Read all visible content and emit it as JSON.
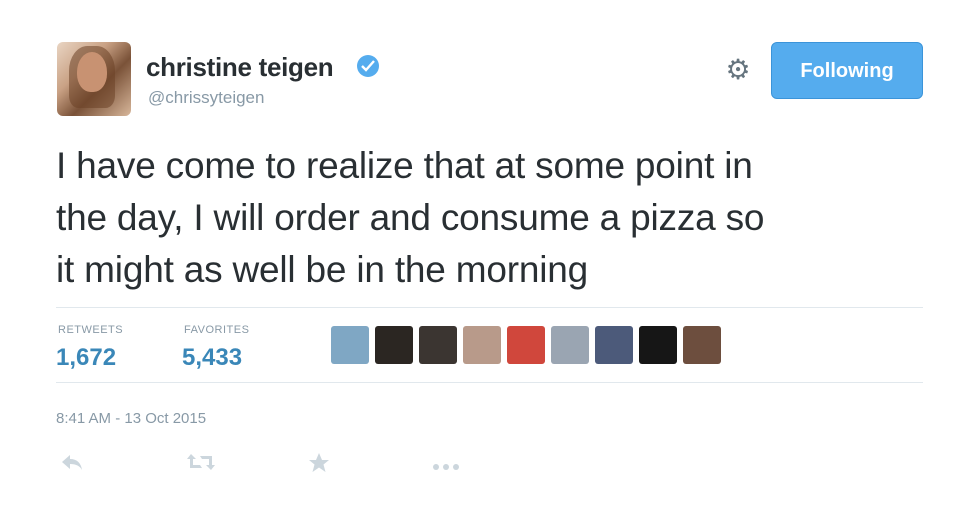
{
  "author": {
    "display_name": "christine teigen",
    "handle": "@chrissyteigen",
    "verified_icon": "verified-badge-icon"
  },
  "header": {
    "follow_label": "Following",
    "gear_icon": "gear-icon"
  },
  "tweet": {
    "text_line1": "I have come to realize that at some point in",
    "text_line2": "the day, I will order and consume a pizza so",
    "text_line3": "it might as well be in the morning"
  },
  "stats": {
    "retweets_label": "RETWEETS",
    "retweets_value": "1,672",
    "favorites_label": "FAVORITES",
    "favorites_value": "5,433"
  },
  "favoriters": [
    {
      "icon": "favoriter-avatar-1",
      "color": "#7fa7c4"
    },
    {
      "icon": "favoriter-avatar-2",
      "color": "#2b2622"
    },
    {
      "icon": "favoriter-avatar-3",
      "color": "#3b3531"
    },
    {
      "icon": "favoriter-avatar-4",
      "color": "#b89a8a"
    },
    {
      "icon": "favoriter-avatar-5",
      "color": "#d0473c"
    },
    {
      "icon": "favoriter-avatar-6",
      "color": "#9aa5b2"
    },
    {
      "icon": "favoriter-avatar-7",
      "color": "#4c5a7a"
    },
    {
      "icon": "favoriter-avatar-8",
      "color": "#161616"
    },
    {
      "icon": "favoriter-avatar-9",
      "color": "#6d4e3e"
    }
  ],
  "timestamp": "8:41 AM - 13 Oct 2015",
  "actions": {
    "reply_icon": "reply-icon",
    "retweet_icon": "retweet-icon",
    "favorite_icon": "star-icon",
    "more_icon": "more-icon"
  },
  "colors": {
    "accent": "#55acee",
    "text": "#292f33",
    "muted": "#8899a6"
  }
}
